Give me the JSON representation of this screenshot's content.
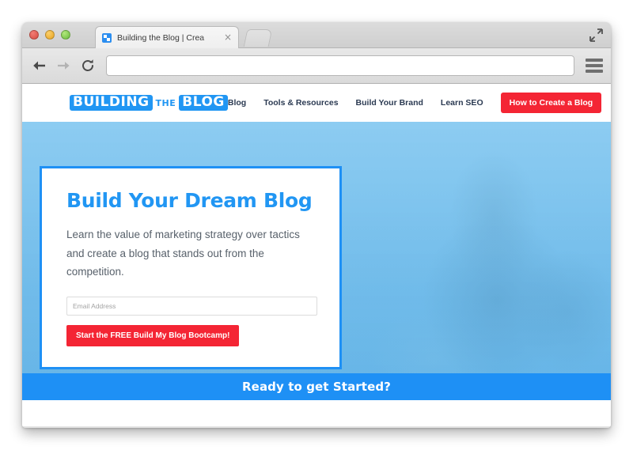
{
  "browser": {
    "window_controls": [
      {
        "name": "close",
        "color": "#d64b40"
      },
      {
        "name": "minimize",
        "color": "#e8a420"
      },
      {
        "name": "zoom",
        "color": "#68ba3c"
      }
    ],
    "fullscreen_icon": "fullscreen-expand-icon",
    "tab": {
      "favicon": "site-favicon",
      "title": "Building the Blog | Crea",
      "close_label": "×"
    },
    "new_tab_label": "",
    "toolbar": {
      "back_icon": "back-arrow-icon",
      "forward_icon": "forward-arrow-icon",
      "reload_icon": "reload-icon",
      "url_value": "",
      "url_placeholder": "",
      "menu_icon": "hamburger-menu-icon"
    }
  },
  "site": {
    "logo": {
      "word1": "BUILDING",
      "word2": "THE",
      "word3": "BLOG",
      "box_color": "#2196f3"
    },
    "nav": {
      "links": [
        {
          "label": "Blog"
        },
        {
          "label": "Tools & Resources"
        },
        {
          "label": "Build Your Brand"
        },
        {
          "label": "Learn SEO"
        }
      ],
      "cta": {
        "label": "How to Create a Blog",
        "color": "#f42534"
      }
    },
    "hero": {
      "title": "Build Your Dream Blog",
      "body": "Learn the value of marketing strategy over tactics and create a blog that stands out from the competition.",
      "email_placeholder": "Email Address",
      "email_value": "",
      "cta_label": "Start the FREE Build My Blog Bootcamp!",
      "cta_color": "#f42534",
      "card_border_color": "#1e90f5",
      "title_color": "#2196f3",
      "photo_description": "woman on couch using laptop, blue overlay"
    },
    "bottom_bar": {
      "text": "Ready to get Started?",
      "background_color": "#1e90f5"
    }
  }
}
